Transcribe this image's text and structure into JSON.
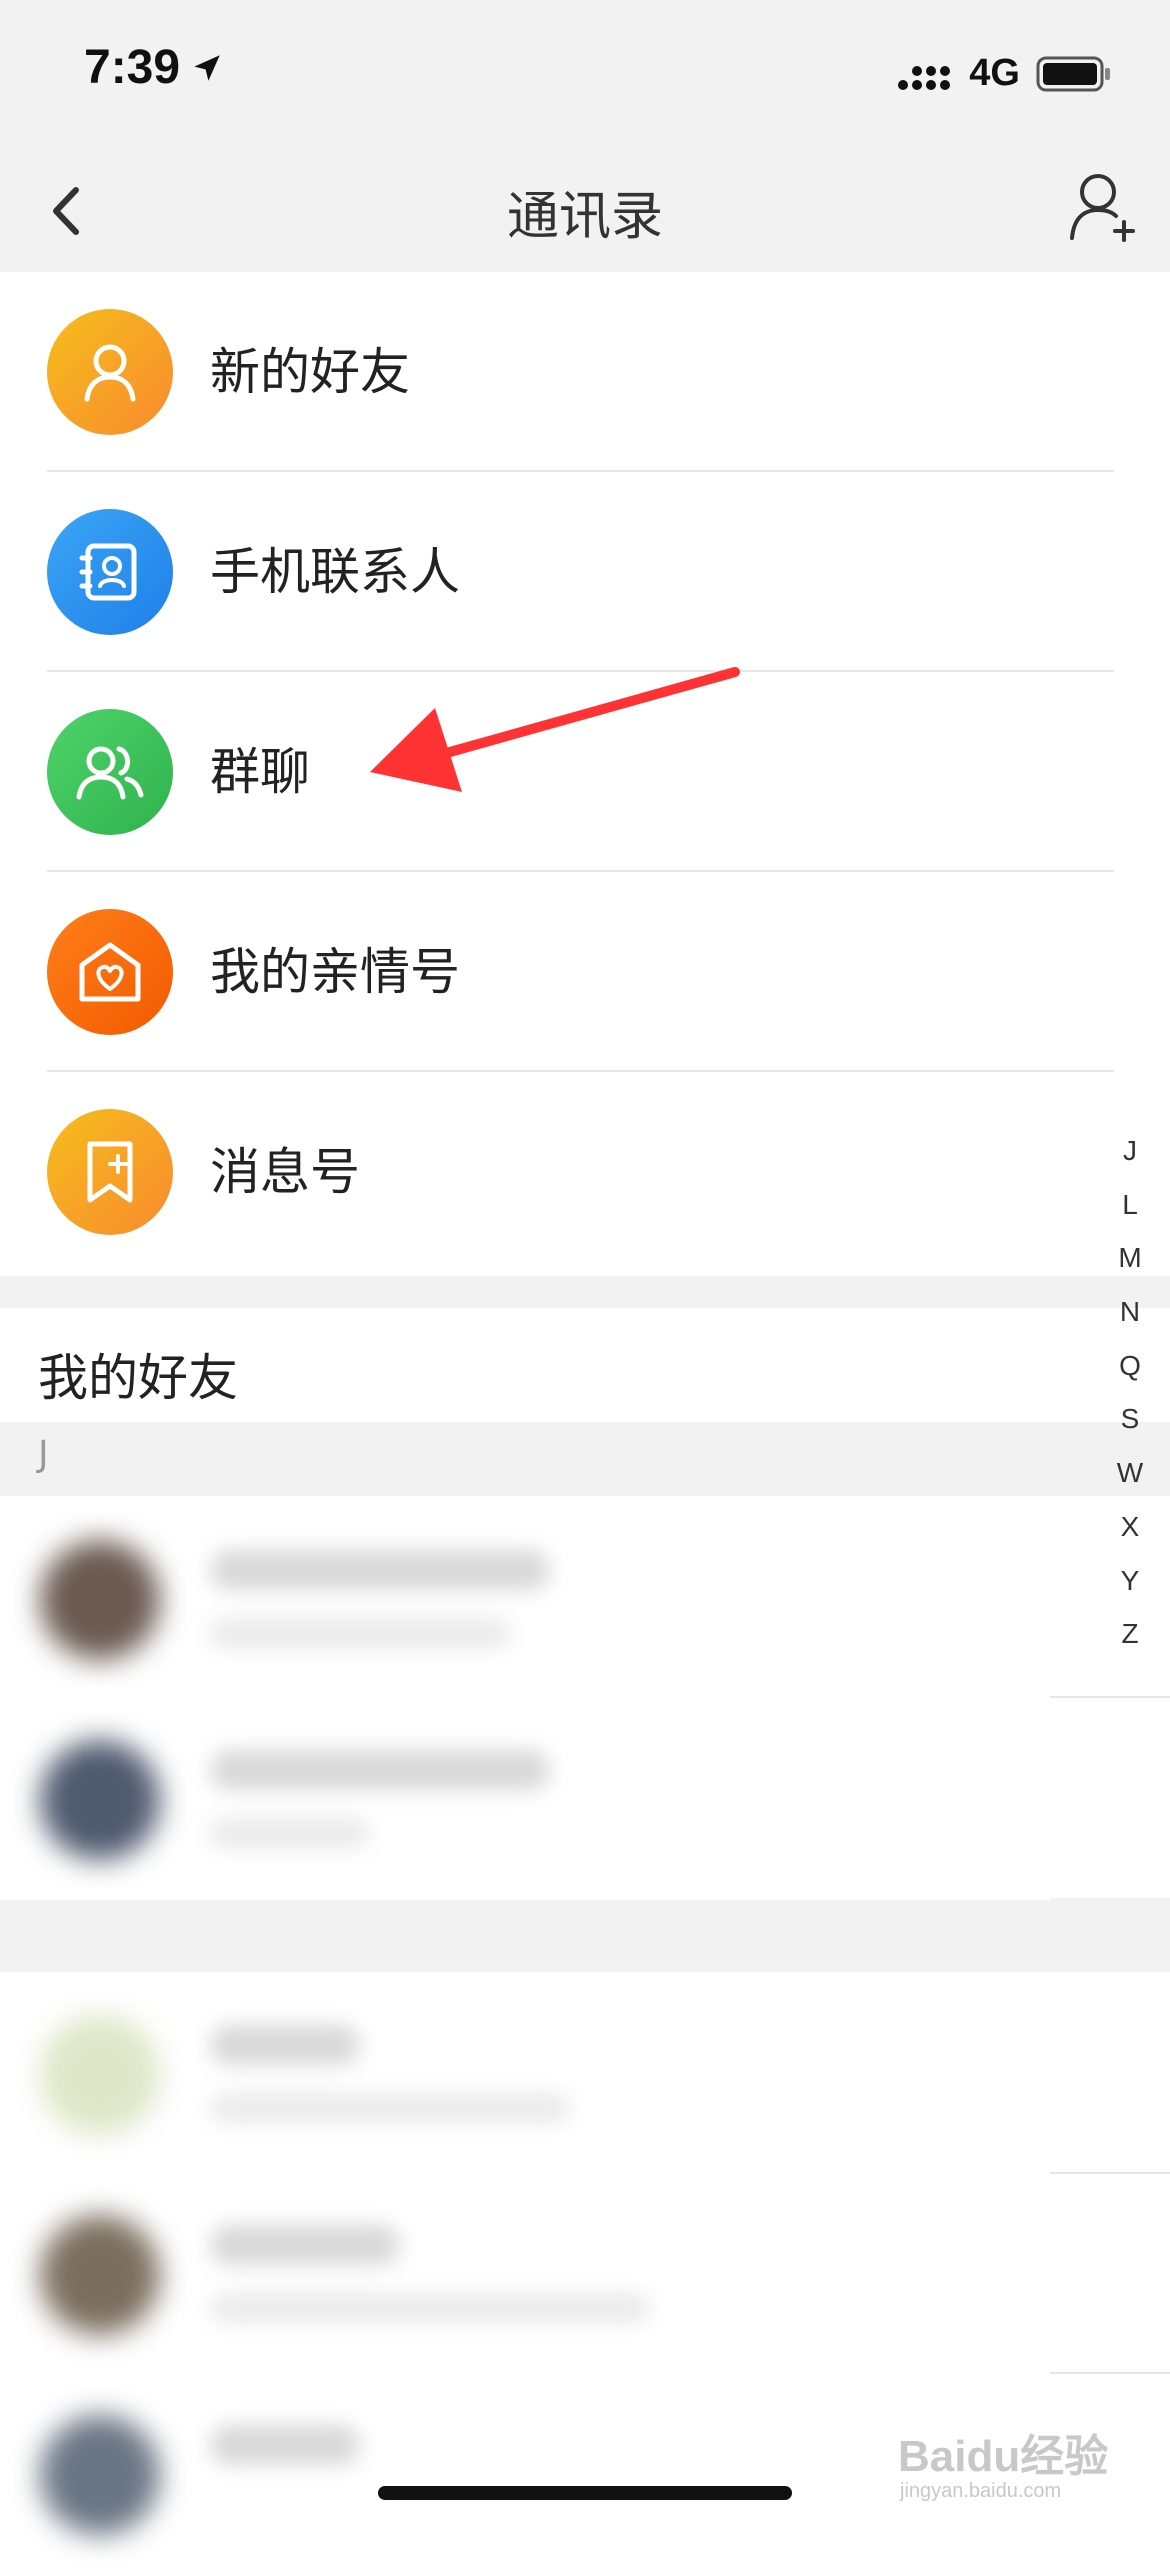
{
  "status": {
    "time": "7:39",
    "network": "4G"
  },
  "nav": {
    "title": "通讯录"
  },
  "menu": [
    {
      "label": "新的好友"
    },
    {
      "label": "手机联系人"
    },
    {
      "label": "群聊"
    },
    {
      "label": "我的亲情号"
    },
    {
      "label": "消息号"
    }
  ],
  "friends": {
    "title": "我的好友",
    "letter": "J"
  },
  "alphabet": [
    "J",
    "L",
    "M",
    "N",
    "Q",
    "S",
    "W",
    "X",
    "Y",
    "Z"
  ],
  "watermark": {
    "brand": "Baidu经验",
    "domain": "jingyan.baidu.com"
  },
  "colors": {
    "accent_red": "#ff3333",
    "green": "#3cc25a",
    "blue": "#2a8ef0",
    "orange": "#ff6a00",
    "yellow": "#f7b21b"
  }
}
